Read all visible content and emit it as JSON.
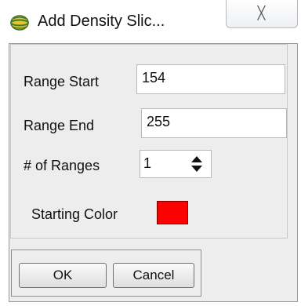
{
  "window": {
    "title": "Add Density Slic...",
    "close_glyph": "╳"
  },
  "form": {
    "range_start": {
      "label": "Range Start",
      "value": "154"
    },
    "range_end": {
      "label": "Range End",
      "value": "255"
    },
    "num_ranges": {
      "label": "# of Ranges",
      "value": "1"
    },
    "starting_color": {
      "label": "Starting Color",
      "color": "#ff0000"
    }
  },
  "buttons": {
    "ok_label": "OK",
    "cancel_label": "Cancel"
  },
  "icons": {
    "app": "globe-icon",
    "close": "close-icon",
    "spinner": "spin-arrows-icon"
  }
}
